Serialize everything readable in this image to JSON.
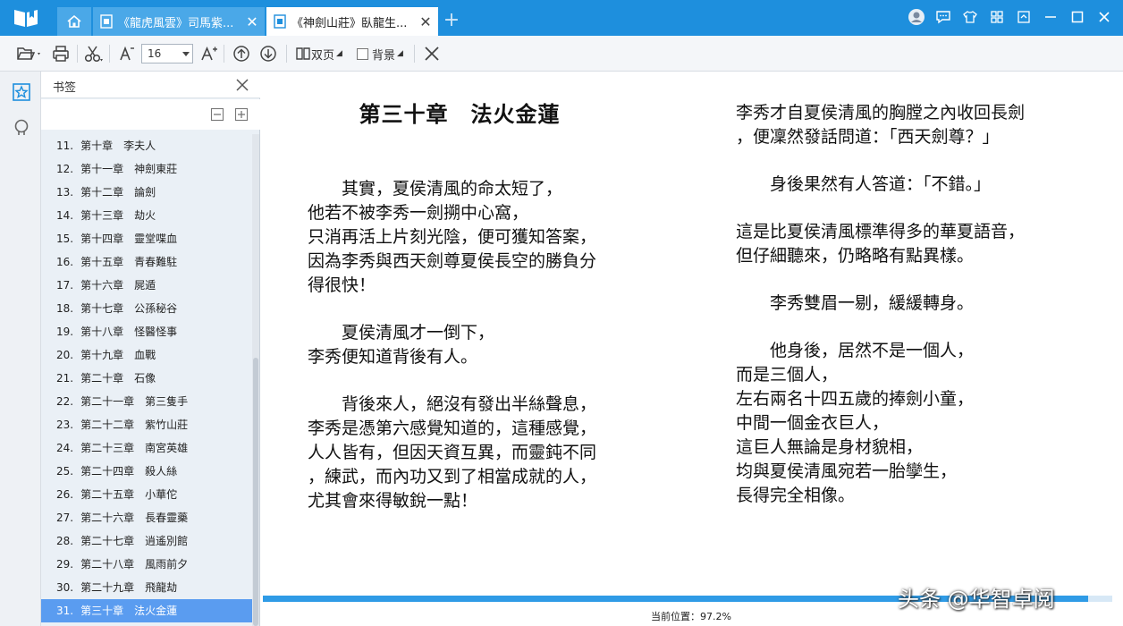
{
  "tabs": [
    {
      "label": "《龍虎風雲》司馬紫..."
    },
    {
      "label": "《神劍山莊》臥龍生..."
    }
  ],
  "toolbar": {
    "font_size": "16",
    "double_page": "双页",
    "background": "背景"
  },
  "bookmark_panel": {
    "title": "书签",
    "items": [
      {
        "num": "11.",
        "label": "第十章　李夫人"
      },
      {
        "num": "12.",
        "label": "第十一章　神劍東莊"
      },
      {
        "num": "13.",
        "label": "第十二章　論劍"
      },
      {
        "num": "14.",
        "label": "第十三章　劫火"
      },
      {
        "num": "15.",
        "label": "第十四章　靈堂喋血"
      },
      {
        "num": "16.",
        "label": "第十五章　青春難駐"
      },
      {
        "num": "17.",
        "label": "第十六章　屍遁"
      },
      {
        "num": "18.",
        "label": "第十七章　公孫秘谷"
      },
      {
        "num": "19.",
        "label": "第十八章　怪醫怪事"
      },
      {
        "num": "20.",
        "label": "第十九章　血戰"
      },
      {
        "num": "21.",
        "label": "第二十章　石像"
      },
      {
        "num": "22.",
        "label": "第二十一章　第三隻手"
      },
      {
        "num": "23.",
        "label": "第二十二章　紫竹山莊"
      },
      {
        "num": "24.",
        "label": "第二十三章　南宮英雄"
      },
      {
        "num": "25.",
        "label": "第二十四章　殺人絲"
      },
      {
        "num": "26.",
        "label": "第二十五章　小華佗"
      },
      {
        "num": "27.",
        "label": "第二十六章　長春靈藥"
      },
      {
        "num": "28.",
        "label": "第二十七章　逍遙別館"
      },
      {
        "num": "29.",
        "label": "第二十八章　風雨前夕"
      },
      {
        "num": "30.",
        "label": "第二十九章　飛龍劫"
      },
      {
        "num": "31.",
        "label": "第三十章　法火金蓮"
      }
    ],
    "selected_index": 20
  },
  "page": {
    "chapter_title": "第三十章　法火金蓮",
    "left_paragraphs": [
      "　　其實，夏侯清風的命太短了，\n他若不被李秀一劍搠中心窩，\n只消再活上片刻光陰，便可獲知答案，\n因為李秀與西天劍尊夏侯長空的勝負分\n得很快！",
      "　　夏侯清風才一倒下，\n李秀便知道背後有人。",
      "　　背後來人，絕沒有發出半絲聲息，\n李秀是憑第六感覺知道的，這種感覺，\n人人皆有，但因天資互異，而靈鈍不同\n，練武，而內功又到了相當成就的人，\n尤其會來得敏銳一點！"
    ],
    "right_paragraphs": [
      "李秀才自夏侯清風的胸膛之內收回長劍\n，便凜然發話問道：「西天劍尊？」",
      "　　身後果然有人答道：「不錯。」",
      "",
      "這是比夏侯清風標準得多的華夏語音，\n但仔細聽來，仍略略有點異樣。",
      "　　李秀雙眉一剔，緩緩轉身。",
      "　　他身後，居然不是一個人，\n而是三個人，\n左右兩名十四五歲的捧劍小童，\n中間一個金衣巨人，\n這巨人無論是身材貌相，\n均與夏侯清風宛若一胎孿生，\n長得完全相像。"
    ]
  },
  "status": {
    "position_text": "当前位置：97.2%",
    "position_value": 97.2
  },
  "watermark": "头条 @华智卓阅",
  "colors": {
    "titlebar": "#1e8fdd",
    "selected": "#5a9cf0",
    "progress": "#2f9be6"
  }
}
